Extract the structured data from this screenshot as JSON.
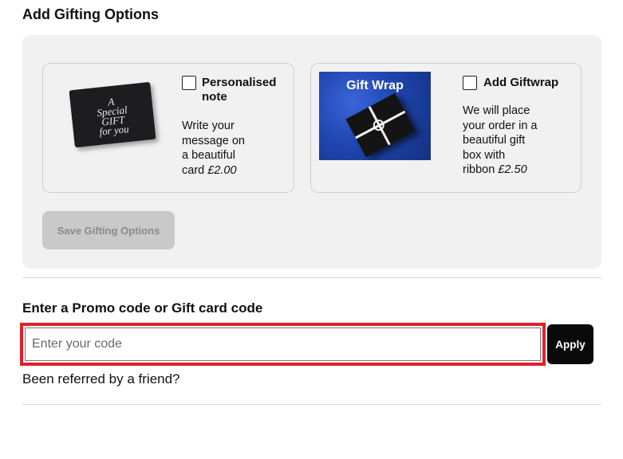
{
  "gifting": {
    "title": "Add Gifting Options",
    "note_option": {
      "image_text": "A\nSpecial\nGIFT\nfor you",
      "label_line1": "Personalised",
      "label_line2": "note",
      "desc_lines": [
        "Write your",
        "message on",
        "a beautiful"
      ],
      "desc_last_prefix": "card ",
      "price": "£2.00",
      "checked": false
    },
    "wrap_option": {
      "image_title": "Gift Wrap",
      "label": "Add Giftwrap",
      "desc_lines": [
        "We will place",
        "your order in a",
        "beautiful gift",
        "box with"
      ],
      "desc_last_prefix": "ribbon ",
      "price": "£2.50",
      "checked": false
    },
    "save_label": "Save Gifting Options"
  },
  "promo": {
    "title": "Enter a Promo code or Gift card code",
    "placeholder": "Enter your code",
    "value": "",
    "apply_label": "Apply",
    "referral_text": "Been referred by a friend?"
  },
  "colors": {
    "panel_bg": "#f1f1f1",
    "highlight_border": "#e0202e",
    "apply_bg": "#0a0a0a",
    "save_disabled_bg": "#c9c9c9"
  }
}
